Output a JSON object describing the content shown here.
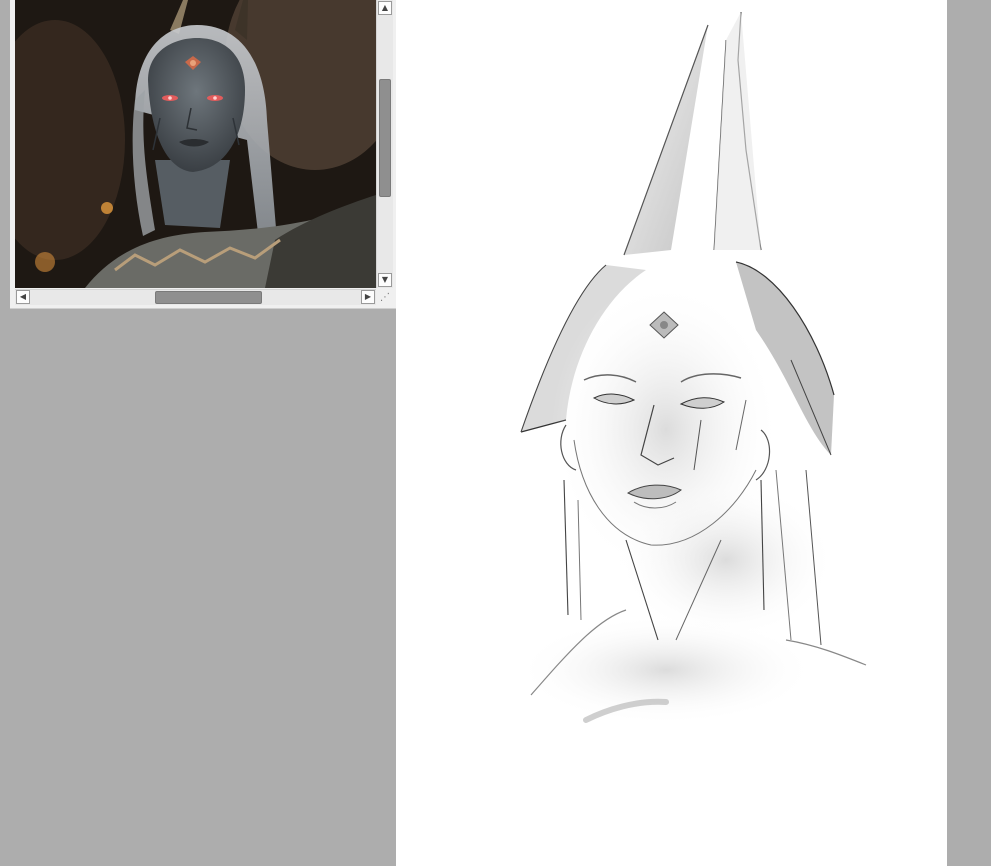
{
  "workspace": {
    "background": "#adadad"
  },
  "reference_window": {
    "image_description_icon": "reference-photo",
    "scroll_up_glyph": "▲",
    "scroll_down_glyph": "▼",
    "scroll_left_glyph": "◀",
    "scroll_right_glyph": "▶",
    "resize_grip_glyph": "⋰"
  },
  "canvas": {
    "background": "#ffffff"
  }
}
